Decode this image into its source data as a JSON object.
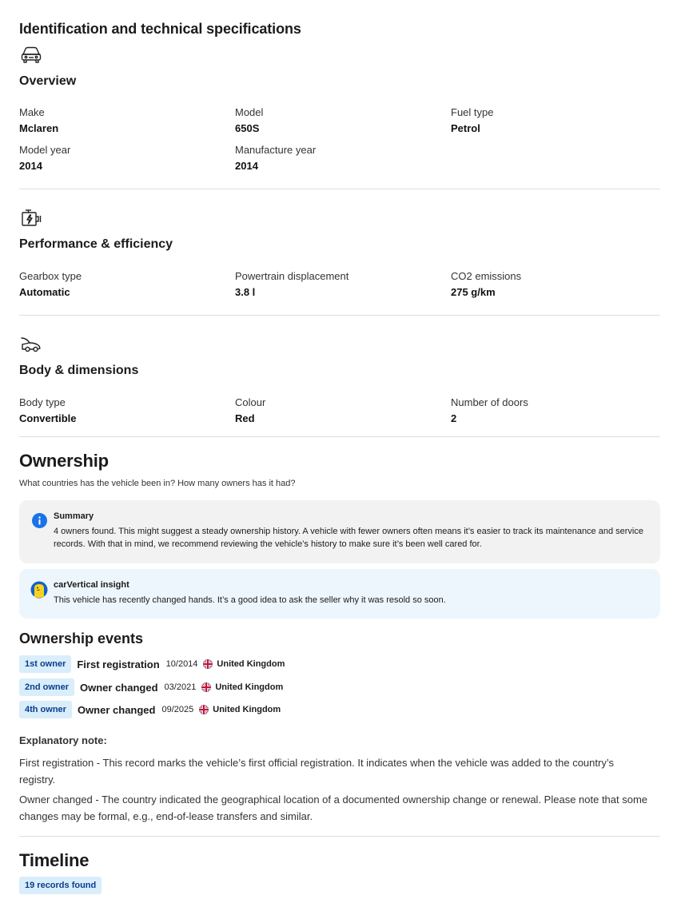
{
  "main_title": "Identification and technical specifications",
  "overview": {
    "icon": "car-front-icon",
    "title": "Overview",
    "specs": [
      {
        "label": "Make",
        "value": "Mclaren"
      },
      {
        "label": "Model",
        "value": "650S"
      },
      {
        "label": "Fuel type",
        "value": "Petrol"
      },
      {
        "label": "Model year",
        "value": "2014"
      },
      {
        "label": "Manufacture year",
        "value": "2014"
      }
    ]
  },
  "performance": {
    "icon": "engine-icon",
    "title": "Performance & efficiency",
    "specs": [
      {
        "label": "Gearbox type",
        "value": "Automatic"
      },
      {
        "label": "Powertrain displacement",
        "value": "3.8 l"
      },
      {
        "label": "CO2 emissions",
        "value": "275 g/km"
      }
    ]
  },
  "body": {
    "icon": "car-side-icon",
    "title": "Body & dimensions",
    "specs": [
      {
        "label": "Body type",
        "value": "Convertible"
      },
      {
        "label": "Colour",
        "value": "Red"
      },
      {
        "label": "Number of doors",
        "value": "2"
      }
    ]
  },
  "ownership": {
    "title": "Ownership",
    "subtitle": "What countries has the vehicle been in? How many owners has it had?",
    "summary": {
      "icon": "info-icon",
      "title": "Summary",
      "text": "4 owners found. This might suggest a steady ownership history. A vehicle with fewer owners often means it’s easier to track its maintenance and service records. With that in mind, we recommend reviewing the vehicle’s history to make sure it’s been well cared for."
    },
    "insight": {
      "icon": "insight-avatar-icon",
      "title": "carVertical insight",
      "text": "This vehicle has recently changed hands. It’s a good idea to ask the seller why it was resold so soon."
    },
    "events_title": "Ownership events",
    "events": [
      {
        "badge": "1st owner",
        "type": "First registration",
        "date": "10/2014",
        "country": "United Kingdom",
        "flag": "uk-flag-icon"
      },
      {
        "badge": "2nd owner",
        "type": "Owner changed",
        "date": "03/2021",
        "country": "United Kingdom",
        "flag": "uk-flag-icon"
      },
      {
        "badge": "4th owner",
        "type": "Owner changed",
        "date": "09/2025",
        "country": "United Kingdom",
        "flag": "uk-flag-icon"
      }
    ],
    "note_title": "Explanatory note:",
    "notes": [
      "First registration - This record marks the vehicle’s first official registration. It indicates when the vehicle was added to the country’s registry.",
      "Owner changed - The country indicated the geographical location of a documented ownership change or renewal. Please note that some changes may be formal, e.g., end-of-lease transfers and similar."
    ]
  },
  "timeline": {
    "title": "Timeline",
    "records_badge": "19 records found"
  },
  "colors": {
    "badge_bg": "#d9edfb",
    "badge_text": "#0a3d8f",
    "info_blue": "#1a73e8",
    "summary_bg": "#f2f2f2",
    "insight_bg": "#eef6fd",
    "divider": "#dedede"
  }
}
